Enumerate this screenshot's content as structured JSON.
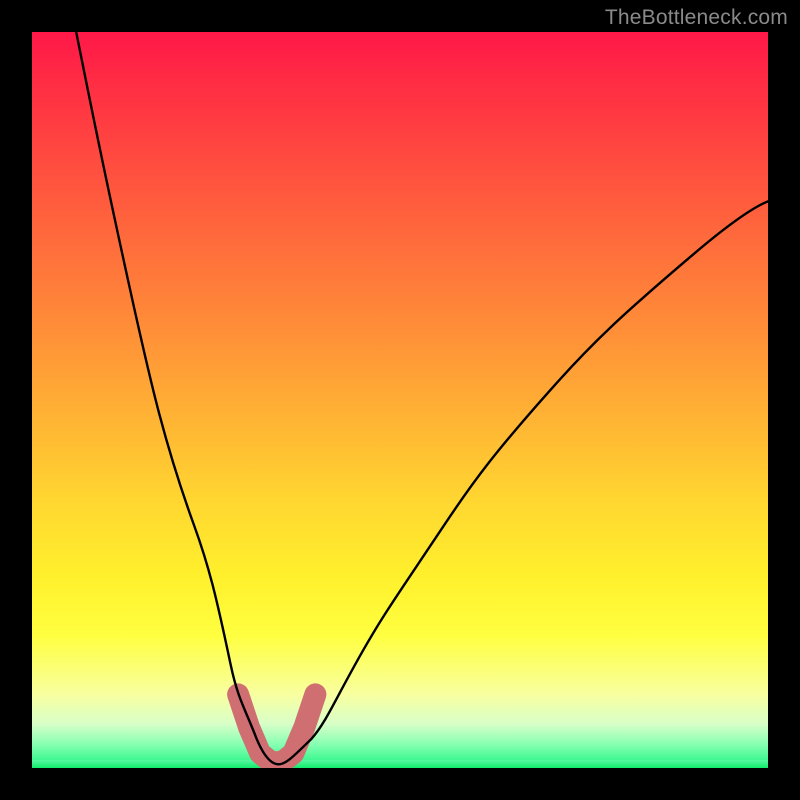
{
  "watermark": "TheBottleneck.com",
  "chart_data": {
    "type": "line",
    "title": "",
    "xlabel": "",
    "ylabel": "",
    "xlim": [
      0,
      100
    ],
    "ylim": [
      0,
      100
    ],
    "grid": false,
    "legend": false,
    "series": [
      {
        "name": "curve",
        "points_xy": [
          [
            6,
            100
          ],
          [
            10,
            80
          ],
          [
            14,
            62
          ],
          [
            18,
            46
          ],
          [
            22,
            33
          ],
          [
            25,
            22
          ],
          [
            27,
            14
          ],
          [
            29,
            8
          ],
          [
            30.5,
            4
          ],
          [
            31.5,
            1.5
          ],
          [
            32.5,
            0.7
          ],
          [
            33.5,
            0.5
          ],
          [
            34.5,
            0.7
          ],
          [
            36,
            1.5
          ],
          [
            38,
            4
          ],
          [
            41,
            9
          ],
          [
            45,
            16
          ],
          [
            50,
            24
          ],
          [
            56,
            33
          ],
          [
            63,
            42
          ],
          [
            71,
            51
          ],
          [
            80,
            59
          ],
          [
            90,
            66
          ],
          [
            100,
            72
          ]
        ]
      },
      {
        "name": "highlight-segment",
        "description": "thick pale-red marker over curve bottom",
        "points_xy": [
          [
            28,
            10
          ],
          [
            29.5,
            5.5
          ],
          [
            31,
            2
          ],
          [
            32.5,
            0.8
          ],
          [
            34,
            0.8
          ],
          [
            35.5,
            2
          ],
          [
            37,
            5.5
          ],
          [
            38.5,
            10
          ]
        ]
      }
    ],
    "colors": {
      "curve": "#000000",
      "highlight": "#cf6f72",
      "gradient_top": "#ff1848",
      "gradient_mid": "#ffd730",
      "gradient_bottom": "#12ea6c"
    }
  }
}
